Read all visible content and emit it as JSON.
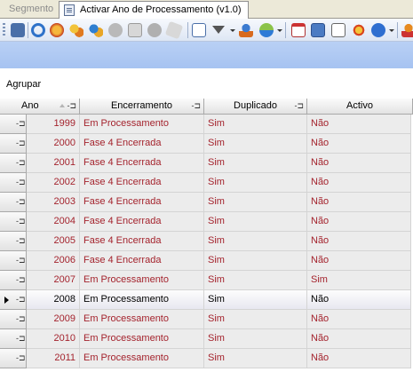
{
  "tabs": [
    {
      "label": "Segmento",
      "active": false
    },
    {
      "label": "Activar Ano de Processamento (v1.0)",
      "active": true
    }
  ],
  "toolbar": {
    "icons": [
      "save-icon",
      "refresh-icon",
      "globe-icon",
      "users-group-icon",
      "users-add-icon",
      "circle-add-icon",
      "copy-icon",
      "circle-remove-icon",
      "eraser-icon",
      "export-table-icon",
      "filter-icon",
      "user-upload-icon",
      "layers-icon",
      "calendar-icon",
      "calculator-icon",
      "edit-note-icon",
      "settings-icon",
      "help-icon",
      "user-icon"
    ]
  },
  "group_bar": {
    "label": "Agrupar"
  },
  "grid": {
    "columns": [
      "Ano",
      "Encerramento",
      "Duplicado",
      "Activo"
    ],
    "sort": {
      "column": "Ano",
      "direction": "ascending"
    },
    "selected_row": 7,
    "rows": [
      {
        "ano": "1999",
        "encerramento": "Em Processamento",
        "duplicado": "Sim",
        "activo": "Não"
      },
      {
        "ano": "2000",
        "encerramento": "Fase 4 Encerrada",
        "duplicado": "Sim",
        "activo": "Não"
      },
      {
        "ano": "2001",
        "encerramento": "Fase 4 Encerrada",
        "duplicado": "Sim",
        "activo": "Não"
      },
      {
        "ano": "2002",
        "encerramento": "Fase 4 Encerrada",
        "duplicado": "Sim",
        "activo": "Não"
      },
      {
        "ano": "2003",
        "encerramento": "Fase 4 Encerrada",
        "duplicado": "Sim",
        "activo": "Não"
      },
      {
        "ano": "2004",
        "encerramento": "Fase 4 Encerrada",
        "duplicado": "Sim",
        "activo": "Não"
      },
      {
        "ano": "2005",
        "encerramento": "Fase 4 Encerrada",
        "duplicado": "Sim",
        "activo": "Não"
      },
      {
        "ano": "2006",
        "encerramento": "Fase 4 Encerrada",
        "duplicado": "Sim",
        "activo": "Não"
      },
      {
        "ano": "2007",
        "encerramento": "Em Processamento",
        "duplicado": "Sim",
        "activo": "Sim"
      },
      {
        "ano": "2008",
        "encerramento": "Em Processamento",
        "duplicado": "Sim",
        "activo": "Não"
      },
      {
        "ano": "2009",
        "encerramento": "Em Processamento",
        "duplicado": "Sim",
        "activo": "Não"
      },
      {
        "ano": "2010",
        "encerramento": "Em Processamento",
        "duplicado": "Sim",
        "activo": "Não"
      },
      {
        "ano": "2011",
        "encerramento": "Em Processamento",
        "duplicado": "Sim",
        "activo": "Não"
      }
    ]
  }
}
